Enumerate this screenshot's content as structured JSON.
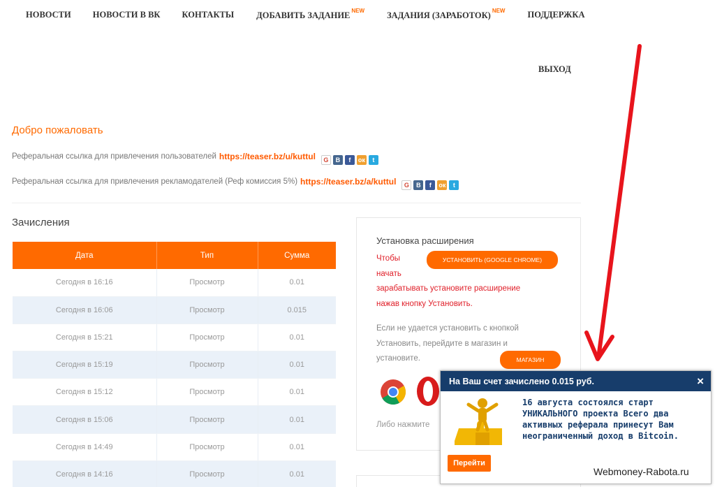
{
  "nav": {
    "items": [
      {
        "label": "НОВОСТИ",
        "badge": ""
      },
      {
        "label": "НОВОСТИ В ВК",
        "badge": ""
      },
      {
        "label": "КОНТАКТЫ",
        "badge": ""
      },
      {
        "label": "ДОБАВИТЬ ЗАДАНИЕ",
        "badge": "NEW"
      },
      {
        "label": "ЗАДАНИЯ (ЗАРАБОТОК)",
        "badge": "NEW"
      },
      {
        "label": "ПОДДЕРЖКА",
        "badge": ""
      }
    ],
    "logout": "ВЫХОД"
  },
  "welcome": "Добро пожаловать",
  "referral": {
    "users_text": "Реферальная ссылка для привлечения пользователей",
    "users_link": "https://teaser.bz/u/kuttul",
    "advertisers_text": "Реферальная ссылка для привлечения рекламодателей (Реф комиссия 5%)",
    "advertisers_link": "https://teaser.bz/a/kuttul",
    "share_icons": [
      "google-plus-icon",
      "vk-icon",
      "facebook-icon",
      "odnoklassniki-icon",
      "twitter-icon"
    ]
  },
  "credits": {
    "title": "Зачисления",
    "columns": [
      "Дата",
      "Тип",
      "Сумма"
    ],
    "rows": [
      [
        "Сегодня в 16:16",
        "Просмотр",
        "0.01"
      ],
      [
        "Сегодня в 16:06",
        "Просмотр",
        "0.015"
      ],
      [
        "Сегодня в 15:21",
        "Просмотр",
        "0.01"
      ],
      [
        "Сегодня в 15:19",
        "Просмотр",
        "0.01"
      ],
      [
        "Сегодня в 15:12",
        "Просмотр",
        "0.01"
      ],
      [
        "Сегодня в 15:06",
        "Просмотр",
        "0.01"
      ],
      [
        "Сегодня в 14:49",
        "Просмотр",
        "0.01"
      ],
      [
        "Сегодня в 14:16",
        "Просмотр",
        "0.01"
      ]
    ]
  },
  "extension": {
    "title": "Установка расширения",
    "red_text_1": "Чтобы",
    "red_text_2": "начать",
    "red_text_3": "зарабатывать установите расширение",
    "red_text_4": "нажав кнопку Установить.",
    "install_button": "УСТАНОВИТЬ (GOOGLE CHROME)",
    "gray_text_1": "Если не удается установить с кнопкой",
    "gray_text_2": "Установить, перейдите в магазин и",
    "gray_text_3": "установите.",
    "shop_button": "МАГАЗИН",
    "bottom_text": "Либо нажмите"
  },
  "popup": {
    "title": "На Ваш счет зачислено 0.015 руб.",
    "close": "×",
    "message": "16 августа состоялся старт УНИКАЛЬНОГО проекта Всего два активных реферала принесут Вам неограниченный доход в Bitcoin.",
    "button": "Перейти"
  },
  "watermark": "Webmoney-Rabota.ru",
  "colors": {
    "accent": "#ff6a00",
    "popup_header": "#173d6b",
    "alert_red": "#e0202a",
    "arrow": "#e8141c"
  }
}
